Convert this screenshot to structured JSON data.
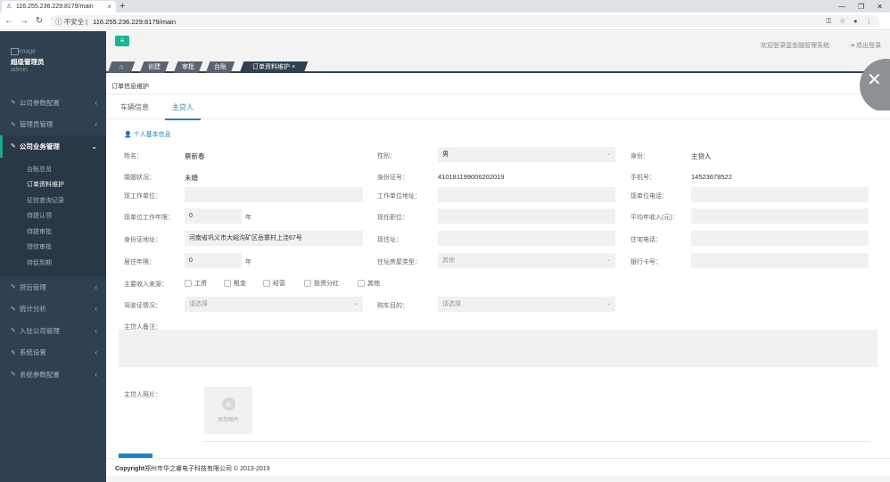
{
  "browser": {
    "tab_title": "116.255.236.229:8179/main",
    "tab_close": "×",
    "new_tab": "+",
    "security": "不安全",
    "url": "116.255.236.229:8179/main"
  },
  "sidebar": {
    "image_alt": "image",
    "role": "超级管理员",
    "username": "admin",
    "items": [
      {
        "label": "公司参数配置"
      },
      {
        "label": "管理员管理"
      },
      {
        "label": "公司业务管理"
      },
      {
        "label": "贷后管理"
      },
      {
        "label": "统计分析"
      },
      {
        "label": "入驻公司管理"
      },
      {
        "label": "系统设置"
      },
      {
        "label": "系统参数配置"
      }
    ],
    "submenu": [
      "台账总览",
      "订单资料维护",
      "征信查询记录",
      "待提认领",
      "待提审批",
      "授信审批",
      "待促到期"
    ]
  },
  "topbar": {
    "menu_icon": "≡",
    "welcome": "欢迎登录壹金融管理系统",
    "logout": "退出登录"
  },
  "page_tabs": [
    {
      "label": "⌂"
    },
    {
      "label": "创建"
    },
    {
      "label": "审批"
    },
    {
      "label": "台账"
    },
    {
      "label": "订单资料维护 ×"
    }
  ],
  "page": {
    "heading": "订单信息维护",
    "tabs": [
      "车辆信息",
      "主贷人"
    ],
    "section_title": "个人基本信息"
  },
  "form": {
    "name_label": "姓名：",
    "name_value": "蔡新春",
    "gender_label": "性别：",
    "gender_value": "男",
    "identity_label": "身份：",
    "identity_value": "主贷人",
    "marital_label": "婚姻状况：",
    "marital_value": "未婚",
    "idcard_label": "身份证号：",
    "idcard_value": "410181199006202019",
    "phone_label": "手机号：",
    "phone_value": "14523678522",
    "employer_label": "现工作单位：",
    "employer_addr_label": "工作单位地址：",
    "employer_phone_label": "现单位电话：",
    "work_years_label": "现单位工作年限：",
    "work_years_value": "0",
    "year_unit": "年",
    "position_label": "现任职位：",
    "income_label": "平均年收入(元)：",
    "id_addr_label": "身份证地址：",
    "id_addr_value": "河南省巩义市大峪沟矿区岳寨村上洼67号",
    "address_label": "现住址：",
    "home_phone_label": "住宅电话：",
    "live_years_label": "居住年限：",
    "live_years_value": "0",
    "house_type_label": "住址房屋类型：",
    "house_type_value": "其他",
    "bank_card_label": "银行卡号：",
    "income_source_label": "主要收入来源：",
    "income_sources": [
      "工资",
      "租金",
      "经营",
      "投资分红",
      "其他"
    ],
    "license_label": "驾驶证情况：",
    "license_placeholder": "请选择",
    "purpose_label": "购车目的：",
    "purpose_placeholder": "请选择",
    "remark_label": "主贷人备注：",
    "photo_label": "主贷人照片：",
    "photo_add": "添加图片"
  },
  "footer": {
    "copyright_bold": "Copyright",
    "copyright_text": "郑州市华之睿电子科技有限公司 © 2013-2019"
  }
}
